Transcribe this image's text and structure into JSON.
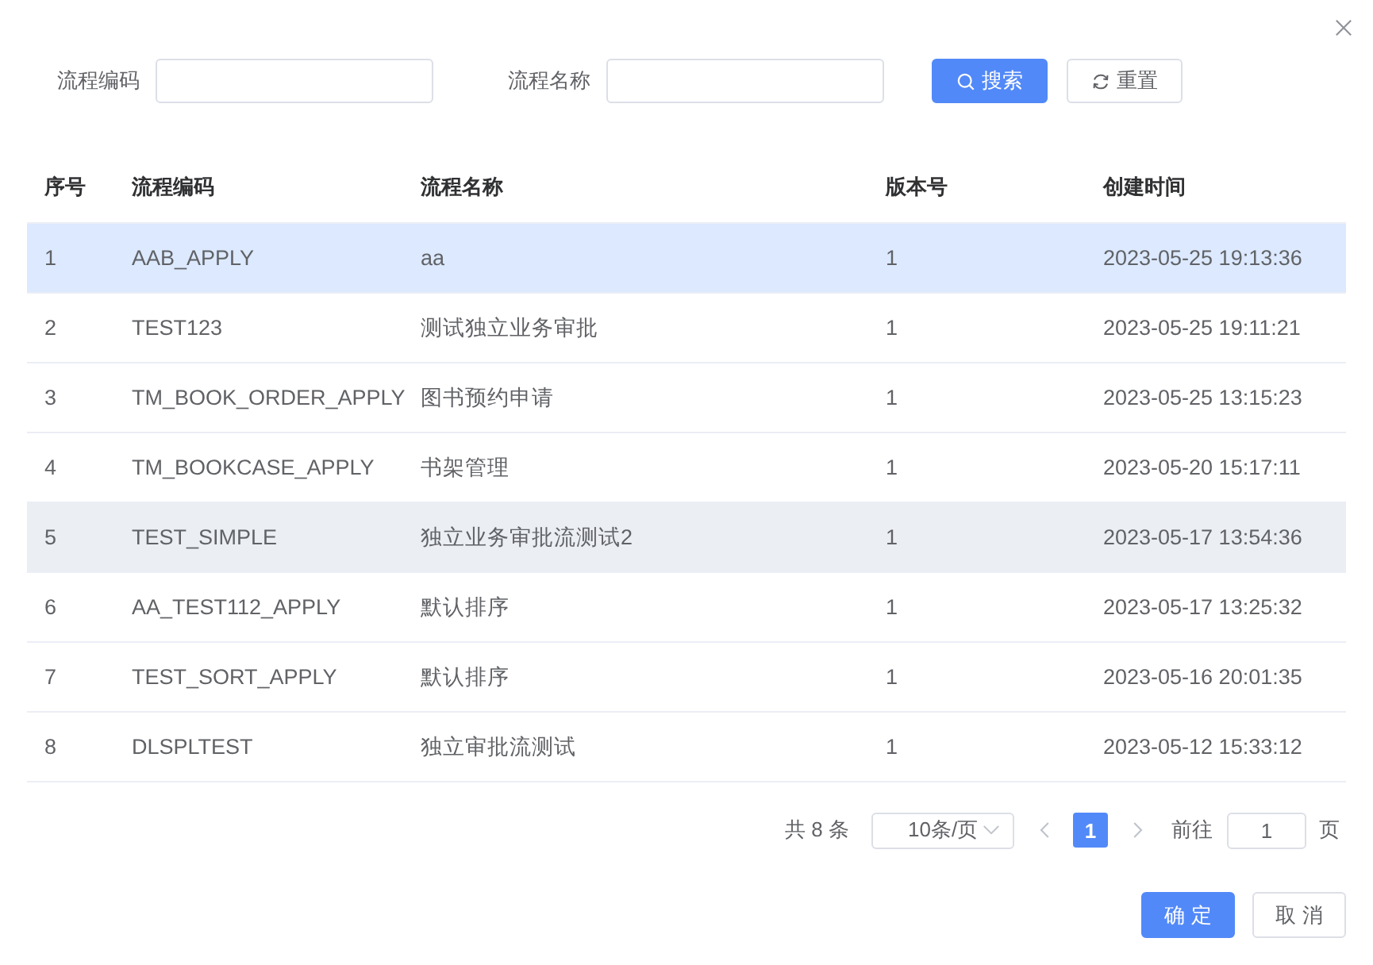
{
  "search": {
    "fields": [
      {
        "label": "流程编码"
      },
      {
        "label": "流程名称"
      }
    ],
    "buttons": [
      {
        "label": "搜索",
        "kind": "primary"
      },
      {
        "label": "重置",
        "kind": "default"
      }
    ]
  },
  "table": {
    "columns": [
      "序号",
      "流程编码",
      "流程名称",
      "版本号",
      "创建时间"
    ],
    "rows": [
      {
        "cells": [
          "1",
          "AAB_APPLY",
          "aa",
          "1",
          "2023-05-25 19:13:36"
        ],
        "selected": true,
        "hovered": false
      },
      {
        "cells": [
          "2",
          "TEST123",
          "测试独立业务审批",
          "1",
          "2023-05-25 19:11:21"
        ],
        "selected": false,
        "hovered": false
      },
      {
        "cells": [
          "3",
          "TM_BOOK_ORDER_APPLY",
          "图书预约申请",
          "1",
          "2023-05-25 13:15:23"
        ],
        "selected": false,
        "hovered": false
      },
      {
        "cells": [
          "4",
          "TM_BOOKCASE_APPLY",
          "书架管理",
          "1",
          "2023-05-20 15:17:11"
        ],
        "selected": false,
        "hovered": false
      },
      {
        "cells": [
          "5",
          "TEST_SIMPLE",
          "独立业务审批流测试2",
          "1",
          "2023-05-17 13:54:36"
        ],
        "selected": false,
        "hovered": true
      },
      {
        "cells": [
          "6",
          "AA_TEST112_APPLY",
          "默认排序",
          "1",
          "2023-05-17 13:25:32"
        ],
        "selected": false,
        "hovered": false
      },
      {
        "cells": [
          "7",
          "TEST_SORT_APPLY",
          "默认排序",
          "1",
          "2023-05-16 20:01:35"
        ],
        "selected": false,
        "hovered": false
      },
      {
        "cells": [
          "8",
          "DLSPLTEST",
          "独立审批流测试",
          "1",
          "2023-05-12 15:33:12"
        ],
        "selected": false,
        "hovered": false
      }
    ]
  },
  "pagination": {
    "total": "共 8 条",
    "page_size": "10条/页",
    "pages": [
      {
        "label": "1",
        "selected": true
      }
    ],
    "goto_label": "前往",
    "goto_value": "1",
    "goto_suffix": "页"
  },
  "footer": {
    "buttons": [
      {
        "label": "确 定",
        "kind": "primary"
      },
      {
        "label": "取 消",
        "kind": "default"
      }
    ]
  }
}
